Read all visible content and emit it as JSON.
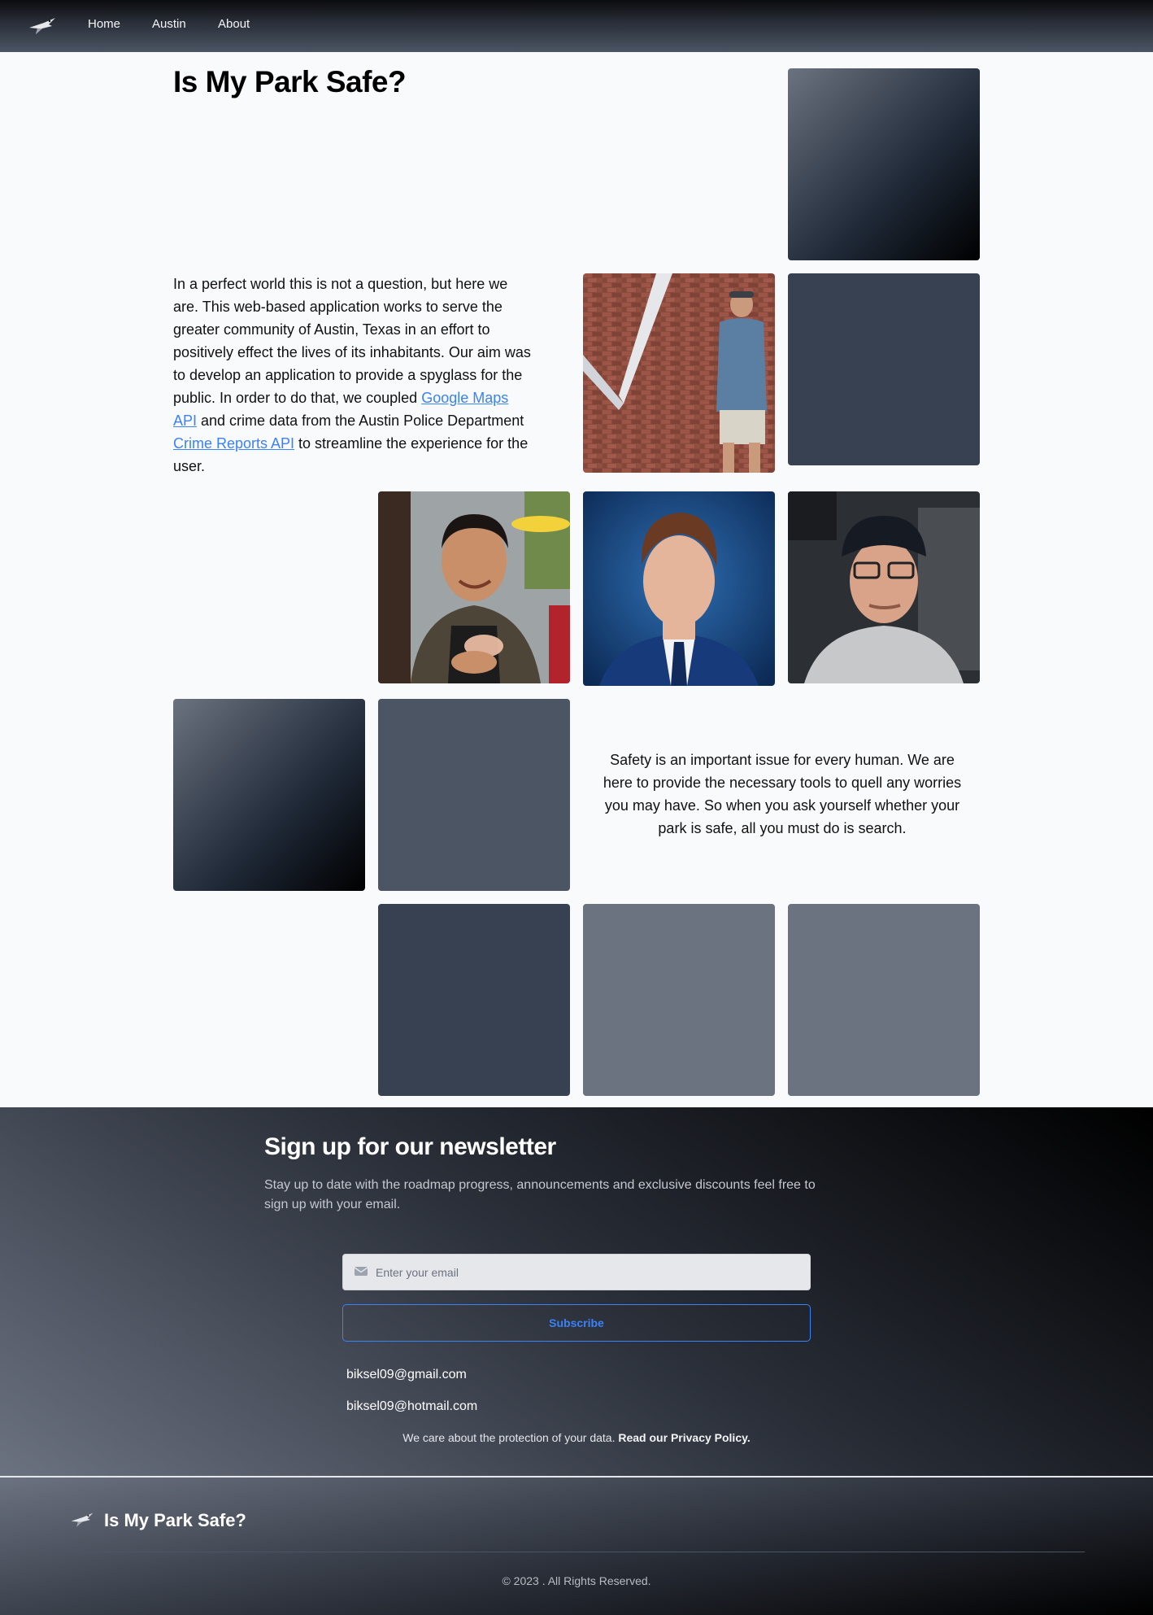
{
  "nav": {
    "items": [
      {
        "label": "Home"
      },
      {
        "label": "Austin"
      },
      {
        "label": "About"
      }
    ]
  },
  "hero": {
    "title": "Is My Park Safe?",
    "intro_part1": "In a perfect world this is not a question, but here we are. This web-based application works to serve the greater community of Austin, Texas in an effort to positively effect the lives of its inhabitants. Our aim was to develop an application to provide a spyglass for the public. In order to do that, we coupled ",
    "link_google_maps": "Google Maps API",
    "intro_part2": " and crime data from the Austin Police Department ",
    "link_crime_reports": "Crime Reports API",
    "intro_part3": " to streamline the experience for the user.",
    "safety_text": "Safety is an important issue for every human. We are here to provide the necessary tools to quell any worries you may have. So when you ask yourself whether your park is safe, all you must do is search."
  },
  "newsletter": {
    "title": "Sign up for our newsletter",
    "description": "Stay up to date with the roadmap progress, announcements and exclusive discounts feel free to sign up with your email.",
    "email_placeholder": "Enter your email",
    "subscribe_label": "Subscribe",
    "contacts": [
      "biksel09@gmail.com",
      "biksel09@hotmail.com"
    ],
    "privacy_text": "We care about the protection of your data. ",
    "privacy_link": "Read our Privacy Policy."
  },
  "footer": {
    "brand": "Is My Park Safe?",
    "copyright": "© 2023 . All Rights Reserved."
  },
  "colors": {
    "accent": "#3b82f6",
    "tile_dark": "#374151",
    "tile_mid": "#4b5563",
    "tile_light": "#6b7280"
  }
}
